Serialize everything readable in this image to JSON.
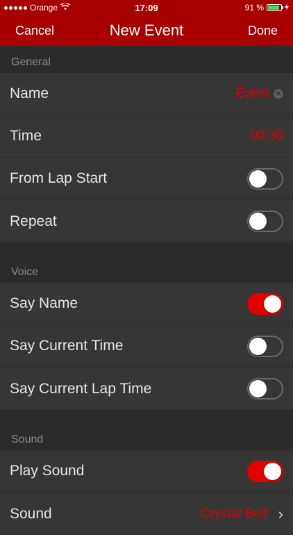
{
  "status": {
    "carrier": "Orange",
    "time": "17:09",
    "battery": "91 %",
    "battery_level": 0.91
  },
  "nav": {
    "cancel": "Cancel",
    "title": "New Event",
    "done": "Done"
  },
  "sections": {
    "general": {
      "header": "General",
      "name_label": "Name",
      "name_value": "Event",
      "time_label": "Time",
      "time_value": "00:30",
      "from_lap_start_label": "From Lap Start",
      "from_lap_start_on": false,
      "repeat_label": "Repeat",
      "repeat_on": false
    },
    "voice": {
      "header": "Voice",
      "say_name_label": "Say Name",
      "say_name_on": true,
      "say_current_time_label": "Say Current Time",
      "say_current_time_on": false,
      "say_current_lap_time_label": "Say Current Lap Time",
      "say_current_lap_time_on": false
    },
    "sound": {
      "header": "Sound",
      "play_sound_label": "Play Sound",
      "play_sound_on": true,
      "sound_label": "Sound",
      "sound_value": "Crystal Bell"
    }
  },
  "colors": {
    "accent": "#a80000",
    "value_red": "#e00000",
    "background": "#2b2b2b",
    "row": "#363636"
  }
}
